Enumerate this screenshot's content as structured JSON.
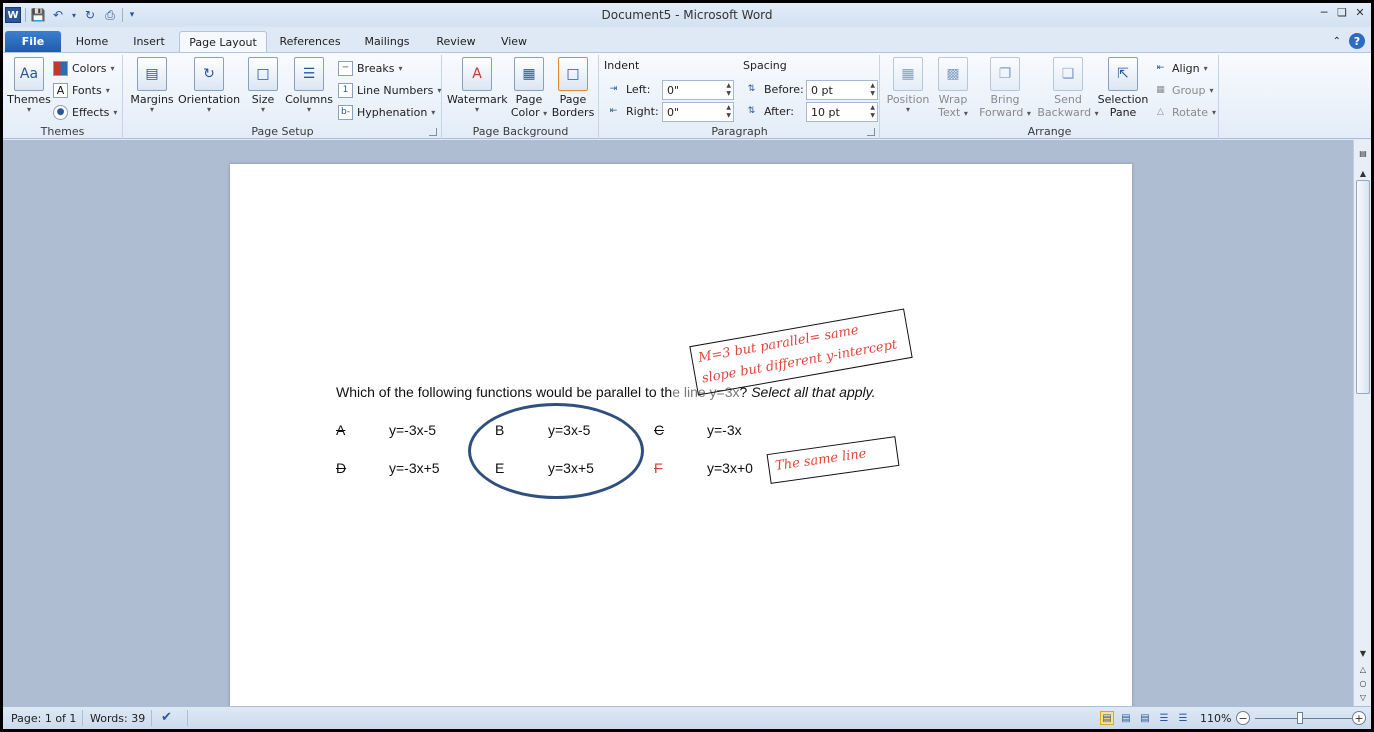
{
  "window": {
    "title": "Document5  -  Microsoft Word",
    "app_icon": "W"
  },
  "tabs": [
    {
      "label": "File"
    },
    {
      "label": "Home"
    },
    {
      "label": "Insert"
    },
    {
      "label": "Page Layout"
    },
    {
      "label": "References"
    },
    {
      "label": "Mailings"
    },
    {
      "label": "Review"
    },
    {
      "label": "View"
    }
  ],
  "ribbon": {
    "themes": {
      "label": "Themes",
      "themes_btn": "Themes",
      "colors": "Colors",
      "fonts": "Fonts",
      "effects": "Effects"
    },
    "page_setup": {
      "label": "Page Setup",
      "margins": "Margins",
      "orientation": "Orientation",
      "size": "Size",
      "columns": "Columns",
      "breaks": "Breaks",
      "line_numbers": "Line Numbers",
      "hyphenation": "Hyphenation"
    },
    "page_background": {
      "label": "Page Background",
      "watermark": "Watermark",
      "page_color_1": "Page",
      "page_color_2": "Color",
      "page_borders_1": "Page",
      "page_borders_2": "Borders"
    },
    "paragraph": {
      "label": "Paragraph",
      "indent": "Indent",
      "left_label": "Left:",
      "left_value": "0\"",
      "right_label": "Right:",
      "right_value": "0\"",
      "spacing": "Spacing",
      "before_label": "Before:",
      "before_value": "0 pt",
      "after_label": "After:",
      "after_value": "10 pt"
    },
    "arrange": {
      "label": "Arrange",
      "position": "Position",
      "wrap_1": "Wrap",
      "wrap_2": "Text",
      "bring_1": "Bring",
      "bring_2": "Forward",
      "send_1": "Send",
      "send_2": "Backward",
      "selection_1": "Selection",
      "selection_2": "Pane",
      "align": "Align",
      "group": "Group",
      "rotate": "Rotate"
    }
  },
  "document": {
    "question_main": "Which of the following functions would be parallel to th",
    "question_faded": "e line y=3x",
    "question_rest": "? ",
    "question_italic": "Select all that apply.",
    "options": [
      {
        "letter": "A",
        "equation": "y=-3x-5"
      },
      {
        "letter": "B",
        "equation": "y=3x-5"
      },
      {
        "letter": "C",
        "equation": "y=-3x"
      },
      {
        "letter": "D",
        "equation": "y=-3x+5"
      },
      {
        "letter": "E",
        "equation": "y=3x+5"
      },
      {
        "letter": "F",
        "equation": "y=3x+0"
      }
    ],
    "annotation_1_line1": "M=3  but  parallel=  same",
    "annotation_1_line2": "slope  but  different y-intercept",
    "annotation_2": "The  same  line"
  },
  "status": {
    "page": "Page: 1 of 1",
    "words": "Words: 39",
    "zoom": "110%"
  }
}
